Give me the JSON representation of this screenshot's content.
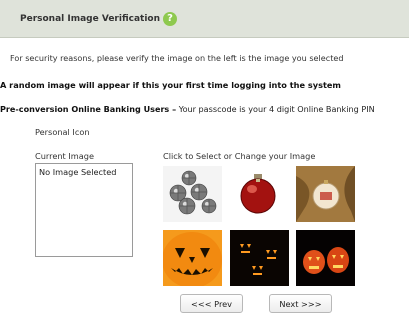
{
  "header": {
    "title": "Personal Image Verification",
    "help_glyph": "?"
  },
  "instructions": {
    "security_note": "For security reasons, please verify the image on the left is the image you selected",
    "random_note": "A random image will appear if this your first time logging into the system",
    "preconversion_bold": "Pre-conversion Online Banking Users –",
    "preconversion_text": " Your passcode is your 4 digit Online Banking PIN"
  },
  "personal_icon": {
    "section_label": "Personal Icon",
    "current_label": "Current Image",
    "current_value": "No Image Selected",
    "select_label": "Click to Select or Change your Image"
  },
  "images": [
    {
      "name": "silver-ornaments-image"
    },
    {
      "name": "red-ornament-image"
    },
    {
      "name": "ornament-tree-image"
    },
    {
      "name": "jack-o-lantern-image"
    },
    {
      "name": "dark-pumpkins-image"
    },
    {
      "name": "glowing-pumpkins-image"
    }
  ],
  "pagination": {
    "prev_label": "<<< Prev",
    "next_label": "Next >>>"
  },
  "colors": {
    "header_bg": "#dfe3da",
    "help_icon": "#8ec94e"
  }
}
